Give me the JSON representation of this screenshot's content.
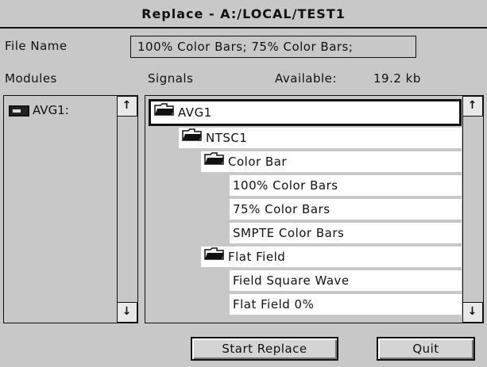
{
  "window": {
    "title": "Replace - A:/LOCAL/TEST1"
  },
  "file_name": {
    "label": "File Name",
    "value": "100% Color  Bars; 75% Color  Bars;"
  },
  "headers": {
    "modules": "Modules",
    "signals": "Signals",
    "available_label": "Available:",
    "available_value": "19.2 kb"
  },
  "modules": [
    {
      "label": "AVG1:"
    }
  ],
  "signals_tree": [
    {
      "label": "AVG1",
      "folder": true,
      "selected": true
    },
    {
      "label": "NTSC1",
      "folder": true
    },
    {
      "label": "Color Bar",
      "folder": true
    },
    {
      "label": "100% Color  Bars",
      "folder": false
    },
    {
      "label": "75% Color  Bars",
      "folder": false
    },
    {
      "label": "SMPTE Color  Bars",
      "folder": false
    },
    {
      "label": "Flat Field",
      "folder": true
    },
    {
      "label": "Field  Square Wave",
      "folder": false
    },
    {
      "label": "Flat  Field 0%",
      "folder": false
    }
  ],
  "scroll": {
    "up": "↑",
    "down": "↓"
  },
  "buttons": {
    "start_replace": "Start Replace",
    "quit": "Quit"
  }
}
